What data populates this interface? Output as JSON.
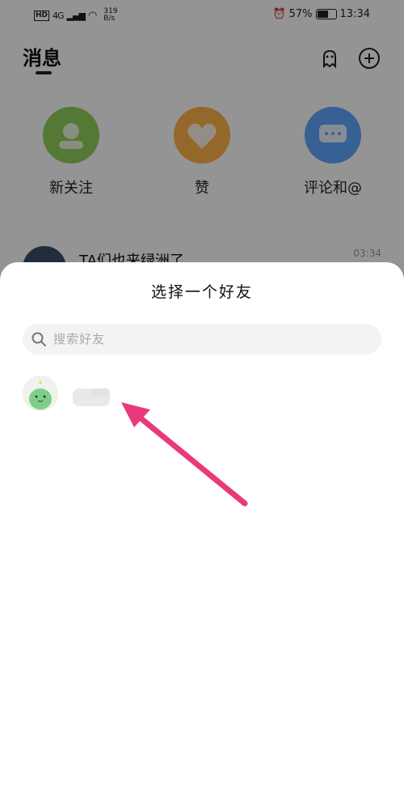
{
  "status_bar": {
    "hd": "HD",
    "network": "4G",
    "speed_value": "319",
    "speed_unit": "B/s",
    "battery": "57%",
    "time": "13:34"
  },
  "header": {
    "title": "消息",
    "ghost_icon": "ghost-icon",
    "add_icon": "plus-circle-icon"
  },
  "quick_actions": [
    {
      "label": "新关注",
      "icon": "new-follower-icon",
      "color": "#8fd15a"
    },
    {
      "label": "赞",
      "icon": "heart-icon",
      "color": "#ffb14a"
    },
    {
      "label": "评论和@",
      "icon": "comment-icon",
      "color": "#5fa8ff"
    }
  ],
  "message_preview": {
    "title": "TA们也来绿洲了",
    "time": "03:34"
  },
  "sheet": {
    "title": "选择一个好友",
    "search_placeholder": "搜索好友",
    "friends": [
      {
        "avatar": "green-dino-avatar"
      }
    ]
  },
  "annotation": {
    "arrow_color": "#e83a7a"
  }
}
